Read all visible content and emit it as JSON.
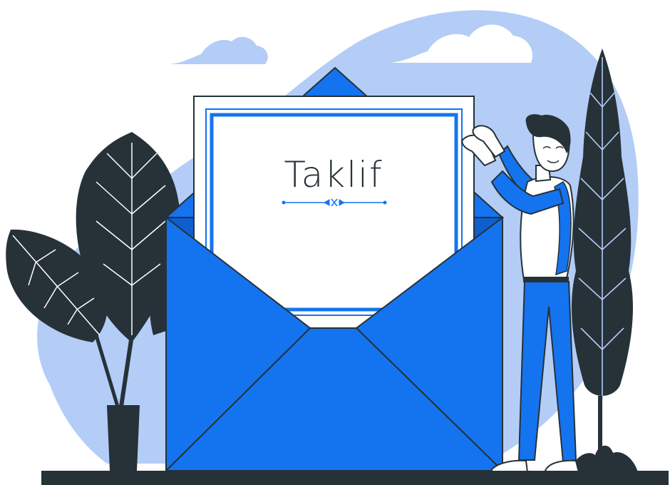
{
  "invitation": {
    "title": "Taklif"
  },
  "colors": {
    "background": "#ffffff",
    "blob": "#b3cdf7",
    "cloud": "#b3cdf7",
    "envelope_blue": "#1474f0",
    "envelope_dark_blue": "#0f5fd0",
    "outline": "#263238",
    "plant_dark": "#263238",
    "plant_vein": "#ffffff",
    "card": "#ffffff",
    "card_border": "#1474f0",
    "skin": "#ffffff",
    "ground": "#263238"
  },
  "icons": {
    "ornament": "divider-ornament-icon",
    "clouds": "cloud-icon",
    "plants": "plant-icon",
    "person": "person-illustration"
  }
}
